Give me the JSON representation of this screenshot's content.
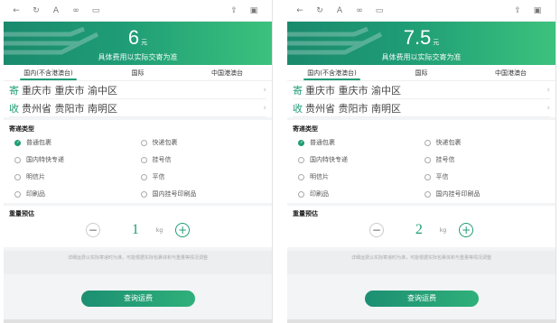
{
  "panels": [
    {
      "price": "6",
      "price_unit": "元",
      "note": "具体费用以实际交寄为准",
      "tabs": [
        "国内(不含港澳台)",
        "国际",
        "中国港澳台"
      ],
      "from_tag": "寄",
      "from": "重庆市 重庆市 渝中区",
      "to_tag": "收",
      "to": "贵州省 贵阳市 南明区",
      "type_title": "寄递类型",
      "options": [
        "普通包裹",
        "快递包裹",
        "国内特快专递",
        "挂号信",
        "明信片",
        "平信",
        "印刷品",
        "国内挂号印刷品"
      ],
      "weight_title": "重量预估",
      "weight": "1",
      "weight_unit": "kg",
      "notice": "详细运费以实际寄递时为准，可能根据实际包裹体积与重量等情况调整",
      "query": "查询运费"
    },
    {
      "price": "7.5",
      "price_unit": "元",
      "note": "具体费用以实际交寄为准",
      "tabs": [
        "国内(不含港澳台)",
        "国际",
        "中国港澳台"
      ],
      "from_tag": "寄",
      "from": "重庆市 重庆市 渝中区",
      "to_tag": "收",
      "to": "贵州省 贵阳市 南明区",
      "type_title": "寄递类型",
      "options": [
        "普通包裹",
        "快递包裹",
        "国内特快专递",
        "挂号信",
        "明信片",
        "平信",
        "印刷品",
        "国内挂号印刷品"
      ],
      "weight_title": "重量预估",
      "weight": "2",
      "weight_unit": "kg",
      "notice": "详细运费以实际寄递时为准，可能根据实际包裹体积与重量等情况调整",
      "query": "查询运费"
    }
  ],
  "colors": {
    "accent": "#1f9d76",
    "hero_start": "#1a8a6d",
    "hero_end": "#3cc27d"
  },
  "icons": [
    "back-icon",
    "refresh-icon",
    "text-size-icon",
    "link-icon",
    "bookmark-icon",
    "share-icon",
    "box-icon"
  ]
}
